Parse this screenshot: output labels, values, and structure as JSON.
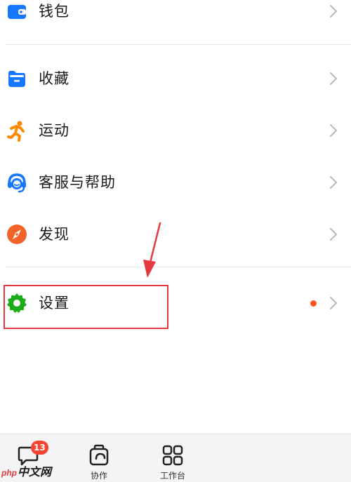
{
  "menu": {
    "items": [
      {
        "id": "wallet",
        "label": "钱包",
        "icon": "wallet-icon"
      },
      {
        "id": "favorites",
        "label": "收藏",
        "icon": "folder-icon"
      },
      {
        "id": "sports",
        "label": "运动",
        "icon": "running-person-icon"
      },
      {
        "id": "support",
        "label": "客服与帮助",
        "icon": "headset-icon"
      },
      {
        "id": "discover",
        "label": "发现",
        "icon": "compass-icon"
      },
      {
        "id": "settings",
        "label": "设置",
        "icon": "gear-icon",
        "has_new_dot": true
      }
    ]
  },
  "tabbar": {
    "tabs": [
      {
        "id": "messages",
        "label": "",
        "icon": "chat-bubble-icon",
        "badge": "13"
      },
      {
        "id": "collaborate",
        "label": "协作",
        "icon": "collaborate-icon"
      },
      {
        "id": "workbench",
        "label": "工作台",
        "icon": "grid-icon"
      }
    ]
  },
  "watermark": {
    "prefix": "php",
    "text": "中文网"
  },
  "colors": {
    "blue": "#1677ff",
    "orange": "#ff8a00",
    "compass_orange": "#f5632a",
    "green": "#1aad19",
    "badge_red": "#f5442f",
    "new_dot": "#ff5722",
    "annotation_red": "#e5383f",
    "chevron": "#b8b8bd"
  }
}
